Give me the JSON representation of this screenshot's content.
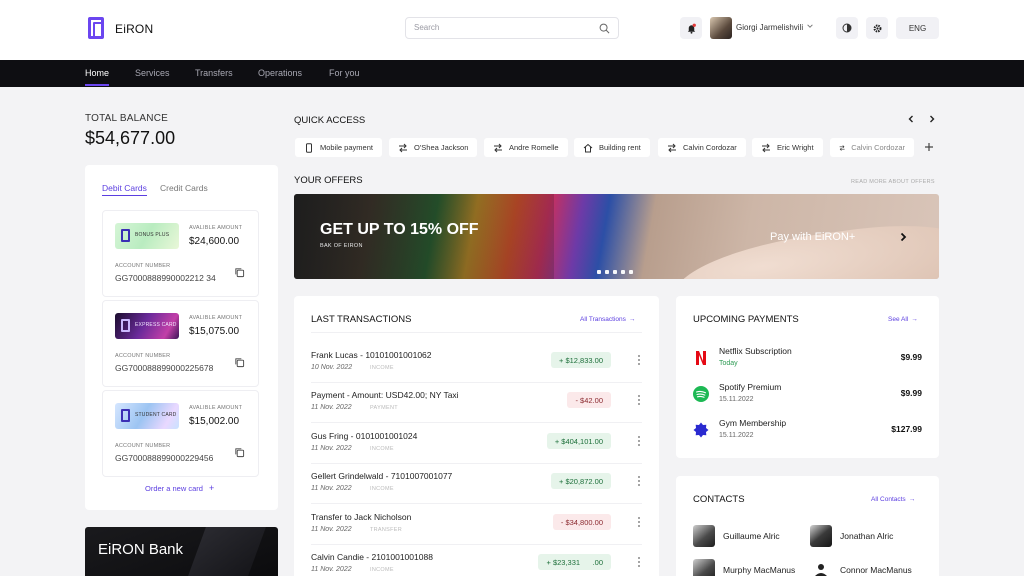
{
  "brand": {
    "name": "EiRON",
    "accent": "#6b46f0"
  },
  "header": {
    "search_placeholder": "Search",
    "user_name": "Giorgi Jarmelishvili",
    "language": "ENG"
  },
  "nav": {
    "items": [
      {
        "label": "Home",
        "active": true
      },
      {
        "label": "Services",
        "active": false
      },
      {
        "label": "Transfers",
        "active": false
      },
      {
        "label": "Operations",
        "active": false
      },
      {
        "label": "For you",
        "active": false
      }
    ]
  },
  "balance": {
    "label": "TOTAL BALANCE",
    "value": "$54,677.00"
  },
  "cards_panel": {
    "tabs": [
      {
        "label": "Debit Cards",
        "active": true
      },
      {
        "label": "Credit Cards",
        "active": false
      }
    ],
    "cards": [
      {
        "card_label": "BONUS PLUS",
        "available_label": "AVALIBLE AMOUNT",
        "available": "$24,600.00",
        "account_label": "ACCOUNT NUMBER",
        "account": "GG7000888990002212 34"
      },
      {
        "card_label": "EXPRESS CARD",
        "available_label": "AVALIBLE AMOUNT",
        "available": "$15,075.00",
        "account_label": "ACCOUNT NUMBER",
        "account": "GG700088899000225678"
      },
      {
        "card_label": "STUDENT CARD",
        "available_label": "AVALIBLE AMOUNT",
        "available": "$15,002.00",
        "account_label": "ACCOUNT NUMBER",
        "account": "GG700088899000229456"
      }
    ],
    "order_new": "Order a new card"
  },
  "bank_card": {
    "title": "EiRON Bank"
  },
  "quick_access": {
    "title": "QUICK ACCESS",
    "items": [
      {
        "label": "Mobile payment",
        "icon": "phone-icon"
      },
      {
        "label": "O'Shea Jackson",
        "icon": "transfer-icon"
      },
      {
        "label": "Andre Romelle",
        "icon": "transfer-icon"
      },
      {
        "label": "Building rent",
        "icon": "home-icon"
      },
      {
        "label": "Calvin Cordozar",
        "icon": "transfer-icon"
      },
      {
        "label": "Eric Wright",
        "icon": "transfer-icon"
      },
      {
        "label": "Calvin Cordozar",
        "icon": "transfer-icon"
      }
    ]
  },
  "offers": {
    "title": "YOUR OFFERS",
    "read_more": "READ MORE ABOUT OFFERS",
    "banner_title": "GET UP TO 15% OFF",
    "banner_sub": "BAK OF EIRON",
    "banner_pay": "Pay with EiRON+"
  },
  "transactions": {
    "title": "LAST TRANSACTIONS",
    "all_label": "All Transactions",
    "rows": [
      {
        "name": "Frank Lucas - 10101001001062",
        "date": "10 Nov. 2022",
        "type": "INCOME",
        "amount": "+ $12,833.00",
        "kind": "income"
      },
      {
        "name": "Payment - Amount: USD42.00; NY Taxi",
        "date": "11 Nov. 2022",
        "type": "PAYMENT",
        "amount": "- $42.00",
        "kind": "expense"
      },
      {
        "name": "Gus Fring - 0101001001024",
        "date": "11 Nov. 2022",
        "type": "INCOME",
        "amount": "+ $404,101.00",
        "kind": "income"
      },
      {
        "name": "Gellert Grindelwald - 7101007001077",
        "date": "11 Nov. 2022",
        "type": "INCOME",
        "amount": "+ $20,872.00",
        "kind": "income"
      },
      {
        "name": "Transfer to Jack Nicholson",
        "date": "11 Nov. 2022",
        "type": "TRANSFER",
        "amount": "- $34,800.00",
        "kind": "expense"
      },
      {
        "name": "Calvin Candie - 2101001001088",
        "date": "11 Nov. 2022",
        "type": "INCOME",
        "amount": "+ $23,331      .00",
        "kind": "income"
      }
    ]
  },
  "upcoming": {
    "title": "UPCOMING PAYMENTS",
    "see_all": "See All",
    "items": [
      {
        "name": "Netflix Subscription",
        "sub": "Today",
        "amount": "$9.99",
        "logo": "netflix-logo",
        "color": "#e50914"
      },
      {
        "name": "Spotify Premium",
        "sub": "15.11.2022",
        "amount": "$9.99",
        "logo": "spotify-logo",
        "color": "#1db954"
      },
      {
        "name": "Gym Membership",
        "sub": "15.11.2022",
        "amount": "$127.99",
        "logo": "gym-logo",
        "color": "#2a2ad0"
      }
    ]
  },
  "contacts": {
    "title": "CONTACTS",
    "all_label": "All Contacts",
    "items": [
      {
        "name": "Guillaume Alric"
      },
      {
        "name": "Jonathan Alric"
      },
      {
        "name": "Murphy MacManus"
      },
      {
        "name": "Connor MacManus"
      }
    ]
  }
}
